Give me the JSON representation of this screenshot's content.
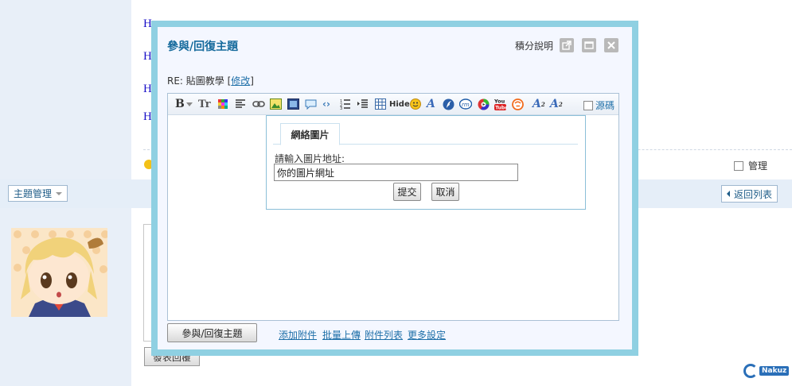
{
  "background": {
    "post_lines": [
      "H",
      "H",
      "H",
      "H"
    ],
    "manage_label": "管理",
    "topic_manage": "主題管理",
    "back_to_list": "返回列表",
    "post_reply_button": "發表回覆",
    "logo_text": "Nakuz"
  },
  "modal": {
    "title": "參與/回復主題",
    "credit_help": "積分說明",
    "reply_prefix": "RE: 貼圖教學 [",
    "edit_link": "修改",
    "reply_suffix": "]",
    "toolbar": {
      "source_label": "源碼",
      "icons": [
        "bold-icon",
        "text-size-icon",
        "color-palette-icon",
        "align-icon",
        "link-icon",
        "image-icon",
        "media-icon",
        "quote-icon",
        "code-icon",
        "ordered-list-icon",
        "indent-icon",
        "table-icon",
        "hide-icon",
        "smiley-icon",
        "font-icon",
        "flash-icon",
        "rm-icon",
        "music-icon",
        "youtube-icon",
        "emoji-icon",
        "superscript-icon",
        "subscript-icon"
      ]
    },
    "image_popup": {
      "tab_label": "網絡圖片",
      "url_label": "請輸入圖片地址:",
      "url_value": "你的圖片網址",
      "submit_label": "提交",
      "cancel_label": "取消"
    },
    "footer": {
      "submit_label": "參與/回復主題",
      "links": [
        "添加附件",
        "批量上傳",
        "附件列表",
        "更多設定"
      ]
    }
  },
  "colors": {
    "modal_border": "#8fd0e2",
    "modal_bg": "#f4f7ff",
    "title_color": "#156a9c",
    "link_color": "#1e6fa8",
    "background_sidebar": "#e8eff8"
  }
}
